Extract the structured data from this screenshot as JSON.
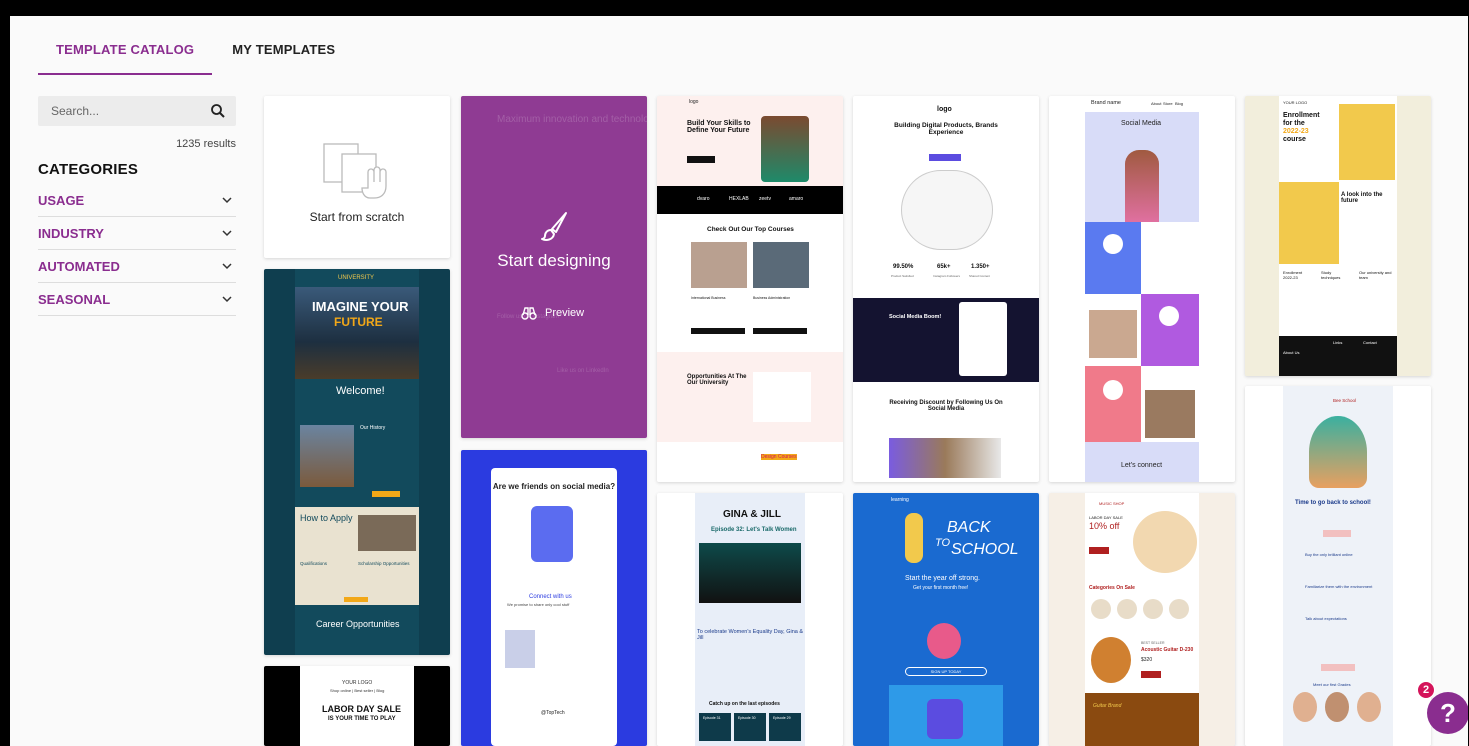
{
  "tabs": [
    {
      "label": "TEMPLATE CATALOG",
      "active": true
    },
    {
      "label": "MY TEMPLATES",
      "active": false
    }
  ],
  "search": {
    "placeholder": "Search...",
    "results": "1235 results"
  },
  "categories": {
    "title": "CATEGORIES",
    "items": [
      "USAGE",
      "INDUSTRY",
      "AUTOMATED",
      "SEASONAL"
    ]
  },
  "cards": {
    "scratch": {
      "label": "Start from scratch"
    },
    "hover": {
      "start": "Start designing",
      "preview": "Preview",
      "ghost_title": "Maximum innovation and technology",
      "ghost_follow": "Follow us on Instagram",
      "ghost_like": "Like us on LinkedIn"
    },
    "university": {
      "brand": "UNIVERSITY",
      "headline1": "IMAGINE YOUR",
      "headline2": "FUTURE",
      "welcome": "Welcome!",
      "history": "Our History",
      "apply": "How to Apply",
      "qual": "Qualifications",
      "scholar": "Scholarship Opportunities",
      "career": "Career Opportunities"
    },
    "labor": {
      "logo": "YOUR LOGO",
      "nav": "Shop online | Best seller | Blog",
      "title": "LABOR DAY SALE",
      "sub": "IS YOUR TIME TO PLAY"
    },
    "social_media": {
      "title": "Are we friends on social media?",
      "connect": "Connect with us",
      "connect_sub": "We promise to share only cool stuff",
      "handle": "@TopTech"
    },
    "courses": {
      "logo": "logo",
      "headline": "Build Your Skills to Define Your Future",
      "brands": [
        "dvaro",
        "HEXLAB",
        "zeetv",
        "amaro"
      ],
      "top": "Check Out Our Top Courses",
      "c1": "International Business",
      "c2": "Business Administration",
      "opps": "Opportunities At The Our University",
      "design": "Design Courses"
    },
    "gina": {
      "title": "GINA & JILL",
      "episode": "Episode 32: Let's Talk Women",
      "intro": "To celebrate Women's Equality Day, Gina & Jill",
      "catch": "Catch up on the last episodes",
      "eps": [
        "Episode 31",
        "Episode 30",
        "Episode 29"
      ]
    },
    "digital": {
      "logo": "logo",
      "headline": "Building Digital Products, Brands Experience",
      "stats": [
        {
          "v": "99.50%",
          "l": "Product Satisfied"
        },
        {
          "v": "65k+",
          "l": "Instagram Followers"
        },
        {
          "v": "1.350+",
          "l": "Shared Content"
        }
      ],
      "boom": "Social Media Boom!",
      "discount": "Receiving Discount by Following Us On Social Media"
    },
    "school": {
      "brand": "learning",
      "line1": "BACK",
      "line2": "TO",
      "line3": "SCHOOL",
      "sub": "Start the year off strong.",
      "sub2": "Get your first month free!",
      "cta": "SIGN UP TODAY"
    },
    "brand_social": {
      "brand": "Brand name",
      "nav": [
        "About",
        "Store",
        "Blog"
      ],
      "title": "Social Media",
      "connect": "Let's connect"
    },
    "music": {
      "brand": "MUSIC SHOP",
      "label": "LABOR DAY SALE",
      "off": "10% off",
      "cats": "Categories On Sale",
      "best": "BEST SELLER",
      "product": "Acoustic Guitar D-230",
      "price": "$320",
      "brands": "Guitar Brand"
    },
    "enroll": {
      "logo": "YOUR LOGO",
      "line1": "Enrollment",
      "line2": "for the",
      "line3": "2022-23",
      "line4": "course",
      "look": "A look into the future",
      "cols": [
        "Enrollment 2022-23",
        "Study techniques",
        "Our university and team"
      ],
      "about": "About Us",
      "links": "Links",
      "contact": "Contact"
    },
    "bee": {
      "brand": "Bee School",
      "title": "Time to go back to school!",
      "f1": "Buy the only brilliant online",
      "f2": "Familiarize them with the environment",
      "f3": "Talk about expectations",
      "meet": "Meet our first Grades"
    }
  },
  "help": {
    "badge": "2",
    "icon": "?"
  },
  "colors": {
    "accent": "#8a2d8f",
    "badge": "#d4145a"
  }
}
